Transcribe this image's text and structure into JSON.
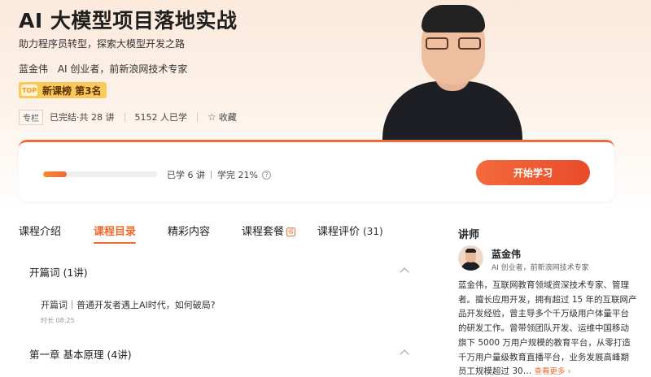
{
  "course": {
    "title": "AI 大模型项目落地实战",
    "subtitle": "助力程序员转型，探索大模型开发之路",
    "author_name": "蓝金伟",
    "author_desc": "AI 创业者，前新浪网技术专家",
    "rank_icon_text": "TOP",
    "rank_label": "新课榜  第3名",
    "tag": "专栏",
    "status": "已完结·共 28 讲",
    "learners": "5152 人已学",
    "favorite_label": "收藏"
  },
  "progress": {
    "learned": "已学 6 讲",
    "completion": "学完 21%",
    "fraction": 0.21,
    "help_icon": "?",
    "start_label": "开始学习"
  },
  "tabs": [
    {
      "label": "课程介绍"
    },
    {
      "label": "课程目录"
    },
    {
      "label": "精彩内容"
    },
    {
      "label": "课程套餐",
      "badge": "省"
    },
    {
      "label": "课程评价",
      "count": "(31)"
    }
  ],
  "chapters": [
    {
      "title": "开篇词 (1讲)",
      "lessons": [
        {
          "title": "开篇词｜普通开发者遇上AI时代，如何破局?",
          "duration": "时长 08:25"
        }
      ]
    },
    {
      "title": "第一章  基本原理 (4讲)"
    }
  ],
  "teacher": {
    "section_title": "讲师",
    "name": "蓝金伟",
    "role": "AI 创业者，前新浪网技术专家",
    "bio": "蓝金伟，互联网教育领域资深技术专家、管理者。擅长应用开发，拥有超过 15 年的互联网产品开发经验，曾主导多个千万级用户体量平台的研发工作。曾带领团队开发、运维中国移动旗下 5000 万用户规模的教育平台，从零打造千万用户量级教育直播平台，业务发展高峰期员工规模超过 30…",
    "more_label": "查看更多 ›"
  },
  "icons": {
    "favorite": "star-icon",
    "chapter_toggle": "chevron-up-icon",
    "help": "question-icon"
  }
}
